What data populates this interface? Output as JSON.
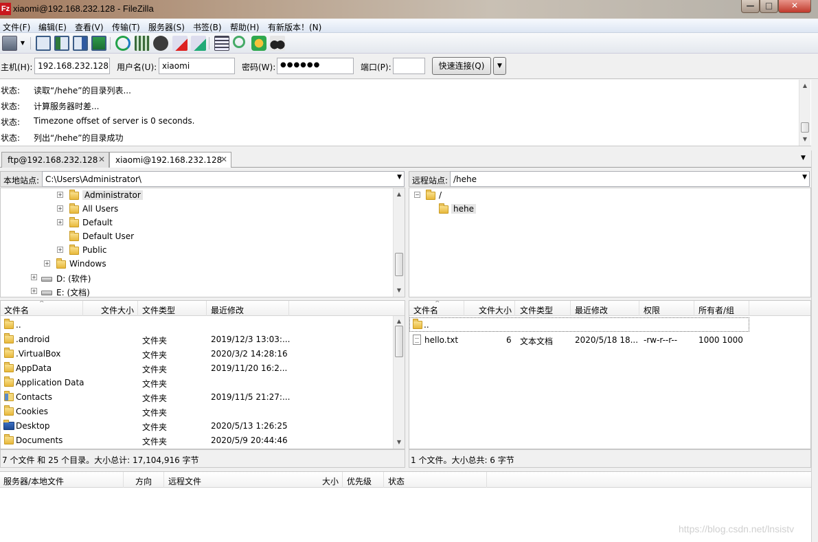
{
  "window": {
    "title": "xiaomi@192.168.232.128 - FileZilla",
    "app_icon": "Fz"
  },
  "menu": [
    "文件(F)",
    "编辑(E)",
    "查看(V)",
    "传输(T)",
    "服务器(S)",
    "书签(B)",
    "帮助(H)",
    "有新版本！(N)"
  ],
  "toolbar": {
    "icons": [
      "site-manager-icon",
      "toggle-log-icon",
      "toggle-local-tree-icon",
      "toggle-remote-tree-icon",
      "toggle-queue-icon",
      "refresh-icon",
      "process-queue-icon",
      "cancel-icon",
      "disconnect-icon",
      "reconnect-icon",
      "filter-icon",
      "search-icon",
      "sync-browse-icon",
      "find-files-icon"
    ]
  },
  "quickconnect": {
    "host_label": "主机(H):",
    "host_value": "192.168.232.128",
    "user_label": "用户名(U):",
    "user_value": "xiaomi",
    "pass_label": "密码(W):",
    "pass_value": "●●●●●●",
    "port_label": "端口(P):",
    "port_value": "",
    "button": "快速连接(Q)",
    "dropdown": "▼"
  },
  "log": [
    {
      "k": "状态:",
      "v": "读取“/hehe”的目录列表..."
    },
    {
      "k": "状态:",
      "v": "计算服务器时差..."
    },
    {
      "k": "状态:",
      "v": "Timezone offset of server is 0 seconds."
    },
    {
      "k": "状态:",
      "v": "列出“/hehe”的目录成功"
    }
  ],
  "tabs": [
    {
      "label": "ftp@192.168.232.128",
      "close": "✕"
    },
    {
      "label": "xiaomi@192.168.232.128",
      "close": "✕"
    }
  ],
  "local": {
    "site_label": "本地站点:",
    "site_path": "C:\\Users\\Administrator\\",
    "tree": [
      "Administrator",
      "All Users",
      "Default",
      "Default User",
      "Public",
      "Windows",
      "D: (软件)",
      "E: (文档)"
    ],
    "columns": [
      "文件名",
      "文件大小",
      "文件类型",
      "最近修改"
    ],
    "files": [
      {
        "name": "..",
        "size": "",
        "type": "",
        "modified": ""
      },
      {
        "name": ".android",
        "size": "",
        "type": "文件夹",
        "modified": "2019/12/3 13:03:..."
      },
      {
        "name": ".VirtualBox",
        "size": "",
        "type": "文件夹",
        "modified": "2020/3/2 14:28:16"
      },
      {
        "name": "AppData",
        "size": "",
        "type": "文件夹",
        "modified": "2019/11/20 16:2..."
      },
      {
        "name": "Application Data",
        "size": "",
        "type": "文件夹",
        "modified": ""
      },
      {
        "name": "Contacts",
        "size": "",
        "type": "文件夹",
        "modified": "2019/11/5 21:27:..."
      },
      {
        "name": "Cookies",
        "size": "",
        "type": "文件夹",
        "modified": ""
      },
      {
        "name": "Desktop",
        "size": "",
        "type": "文件夹",
        "modified": "2020/5/13 1:26:25"
      },
      {
        "name": "Documents",
        "size": "",
        "type": "文件夹",
        "modified": "2020/5/9 20:44:46"
      }
    ],
    "status": "7 个文件 和 25 个目录。大小总计: 17,104,916 字节"
  },
  "remote": {
    "site_label": "远程站点:",
    "site_path": "/hehe",
    "tree": [
      "/",
      "hehe"
    ],
    "columns": [
      "文件名",
      "文件大小",
      "文件类型",
      "最近修改",
      "权限",
      "所有者/组"
    ],
    "files": [
      {
        "name": "..",
        "size": "",
        "type": "",
        "modified": "",
        "perm": "",
        "owner": ""
      },
      {
        "name": "hello.txt",
        "size": "6",
        "type": "文本文档",
        "modified": "2020/5/18 18...",
        "perm": "-rw-r--r--",
        "owner": "1000 1000"
      }
    ],
    "status": "1 个文件。大小总共: 6 字节"
  },
  "queue": {
    "columns": [
      "服务器/本地文件",
      "方向",
      "远程文件",
      "大小",
      "优先级",
      "状态"
    ]
  },
  "watermark": "https://blog.csdn.net/lnsistv",
  "glyphs": {
    "up": "▲",
    "down": "▼",
    "plus": "+",
    "minus": "−",
    "min": "—",
    "max": "□",
    "close": "✕",
    "caret": "^"
  }
}
